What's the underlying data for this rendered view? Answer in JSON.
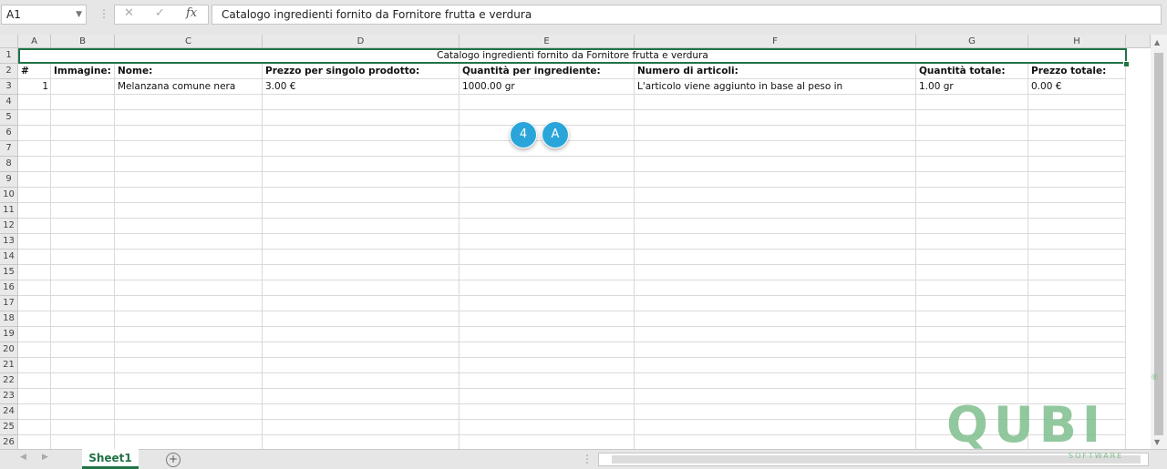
{
  "formula_bar": {
    "name_box": "A1",
    "cancel": "✕",
    "enter": "✓",
    "fx": "fx",
    "value": "Catalogo ingredienti fornito da Fornitore frutta e verdura"
  },
  "columns": [
    "A",
    "B",
    "C",
    "D",
    "E",
    "F",
    "G",
    "H"
  ],
  "rows": [
    "1",
    "2",
    "3",
    "4",
    "5",
    "6",
    "7",
    "8",
    "9",
    "10",
    "11",
    "12",
    "13",
    "14",
    "15",
    "16",
    "17",
    "18",
    "19",
    "20",
    "21",
    "22",
    "23",
    "24",
    "25",
    "26"
  ],
  "sheet": {
    "title": "Catalogo ingredienti fornito da Fornitore frutta e verdura",
    "headers": [
      "#",
      "Immagine:",
      "Nome:",
      "Prezzo per singolo prodotto:",
      "Quantità per ingrediente:",
      "Numero di articoli:",
      "Quantità totale:",
      "Prezzo totale:"
    ],
    "row3": [
      "1",
      "",
      "Melanzana comune nera",
      "3.00 €",
      "1000.00 gr",
      "L'articolo viene aggiunto in base al peso in",
      "1.00 gr",
      "0.00 €"
    ]
  },
  "badges": [
    "4",
    "A"
  ],
  "tabs": {
    "active": "Sheet1",
    "add": "+"
  },
  "watermark": {
    "text": "QUBI",
    "sub": "SOFTWARE",
    "reg": "®"
  },
  "colors": {
    "excel_green": "#217346",
    "badge_blue": "#2aa5d9",
    "watermark_green": "#7fbf8e"
  }
}
